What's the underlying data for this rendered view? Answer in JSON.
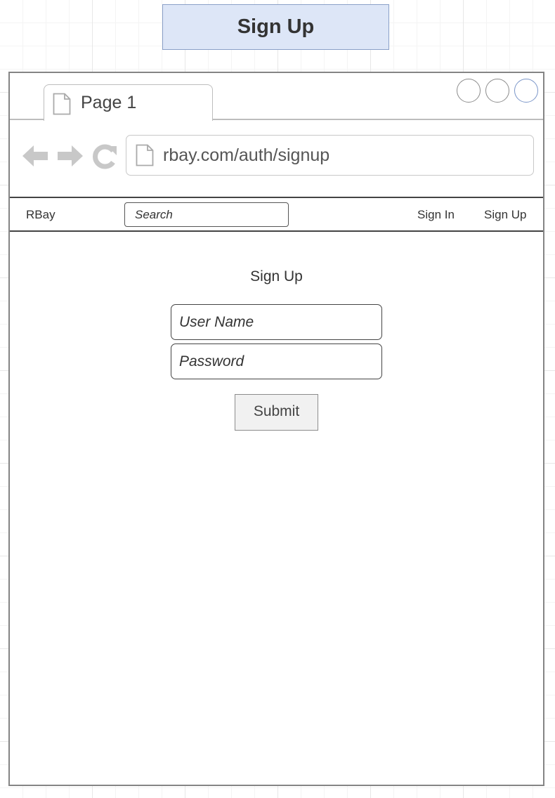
{
  "diagram_title": "Sign Up",
  "browser": {
    "tab_label": "Page 1",
    "url": "rbay.com/auth/signup",
    "controls": [
      "circle-icon",
      "circle-icon",
      "circle-icon"
    ],
    "nav_icons": [
      "back-arrow-icon",
      "forward-arrow-icon",
      "reload-icon"
    ]
  },
  "navbar": {
    "brand": "RBay",
    "search_placeholder": "Search",
    "links": [
      "Sign In",
      "Sign Up"
    ]
  },
  "form": {
    "title": "Sign Up",
    "username_placeholder": "User Name",
    "password_placeholder": "Password",
    "submit_label": "Submit"
  },
  "colors": {
    "title_fill": "#dde6f7",
    "title_border": "#8aa0c8",
    "wireframe_gray": "#c8c8c8"
  }
}
